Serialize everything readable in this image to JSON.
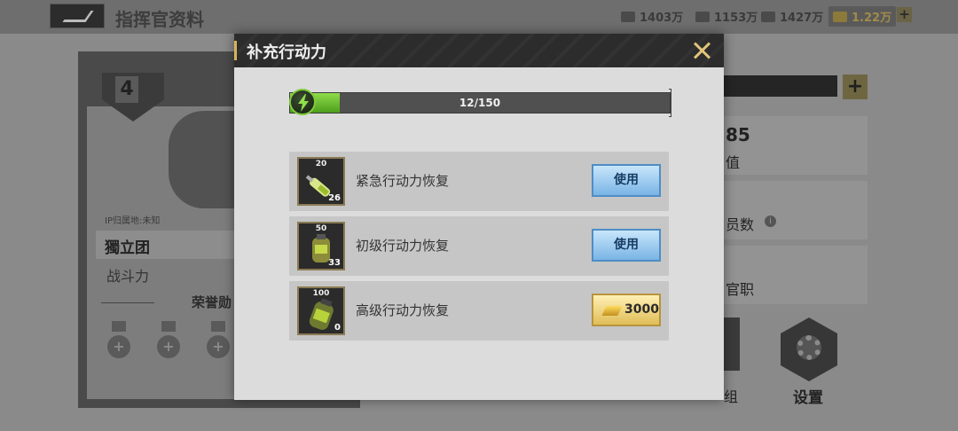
{
  "header": {
    "page_title": "指挥官资料",
    "resources": [
      "1403万",
      "1153万",
      "1427万",
      "1.22万"
    ],
    "plus_label": "+"
  },
  "profile": {
    "rank": "4",
    "ip_location": "IP归属地:未知",
    "corps_name": "獨立团",
    "power_label": "战斗力",
    "medals_title": "荣誉勋",
    "medal_plus": "+"
  },
  "right_panel": {
    "plus_label": "+",
    "number_partial": "85",
    "label_1": "值",
    "label_2": "员数",
    "info_icon": "i",
    "label_3": "官职",
    "label_4": "组",
    "settings_label": "设置"
  },
  "modal": {
    "title": "补充行动力",
    "close_icon": "close-x-icon",
    "stamina": {
      "current": 12,
      "max": 150,
      "text": "12/150"
    },
    "items": [
      {
        "amount": "20",
        "count": "26",
        "name": "紧急行动力恢复",
        "action_label": "使用",
        "action_type": "use"
      },
      {
        "amount": "50",
        "count": "33",
        "name": "初级行动力恢复",
        "action_label": "使用",
        "action_type": "use"
      },
      {
        "amount": "100",
        "count": "0",
        "name": "高级行动力恢复",
        "action_label": "3000",
        "action_type": "gold"
      }
    ]
  },
  "colors": {
    "accent_gold": "#d5b35b",
    "use_button_blue": "#79b4e5",
    "stamina_green": "#6fcf32"
  }
}
